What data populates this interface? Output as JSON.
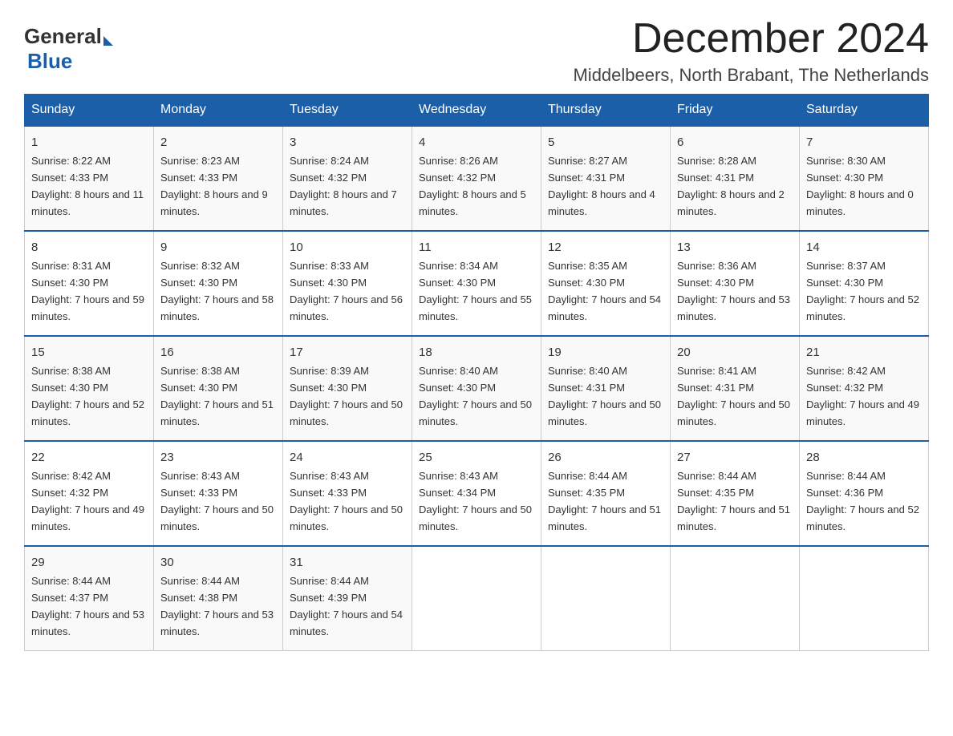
{
  "header": {
    "logo_general": "General",
    "logo_blue": "Blue",
    "month_title": "December 2024",
    "location": "Middelbeers, North Brabant, The Netherlands"
  },
  "days_of_week": [
    "Sunday",
    "Monday",
    "Tuesday",
    "Wednesday",
    "Thursday",
    "Friday",
    "Saturday"
  ],
  "weeks": [
    [
      {
        "day": "1",
        "sunrise": "Sunrise: 8:22 AM",
        "sunset": "Sunset: 4:33 PM",
        "daylight": "Daylight: 8 hours and 11 minutes."
      },
      {
        "day": "2",
        "sunrise": "Sunrise: 8:23 AM",
        "sunset": "Sunset: 4:33 PM",
        "daylight": "Daylight: 8 hours and 9 minutes."
      },
      {
        "day": "3",
        "sunrise": "Sunrise: 8:24 AM",
        "sunset": "Sunset: 4:32 PM",
        "daylight": "Daylight: 8 hours and 7 minutes."
      },
      {
        "day": "4",
        "sunrise": "Sunrise: 8:26 AM",
        "sunset": "Sunset: 4:32 PM",
        "daylight": "Daylight: 8 hours and 5 minutes."
      },
      {
        "day": "5",
        "sunrise": "Sunrise: 8:27 AM",
        "sunset": "Sunset: 4:31 PM",
        "daylight": "Daylight: 8 hours and 4 minutes."
      },
      {
        "day": "6",
        "sunrise": "Sunrise: 8:28 AM",
        "sunset": "Sunset: 4:31 PM",
        "daylight": "Daylight: 8 hours and 2 minutes."
      },
      {
        "day": "7",
        "sunrise": "Sunrise: 8:30 AM",
        "sunset": "Sunset: 4:30 PM",
        "daylight": "Daylight: 8 hours and 0 minutes."
      }
    ],
    [
      {
        "day": "8",
        "sunrise": "Sunrise: 8:31 AM",
        "sunset": "Sunset: 4:30 PM",
        "daylight": "Daylight: 7 hours and 59 minutes."
      },
      {
        "day": "9",
        "sunrise": "Sunrise: 8:32 AM",
        "sunset": "Sunset: 4:30 PM",
        "daylight": "Daylight: 7 hours and 58 minutes."
      },
      {
        "day": "10",
        "sunrise": "Sunrise: 8:33 AM",
        "sunset": "Sunset: 4:30 PM",
        "daylight": "Daylight: 7 hours and 56 minutes."
      },
      {
        "day": "11",
        "sunrise": "Sunrise: 8:34 AM",
        "sunset": "Sunset: 4:30 PM",
        "daylight": "Daylight: 7 hours and 55 minutes."
      },
      {
        "day": "12",
        "sunrise": "Sunrise: 8:35 AM",
        "sunset": "Sunset: 4:30 PM",
        "daylight": "Daylight: 7 hours and 54 minutes."
      },
      {
        "day": "13",
        "sunrise": "Sunrise: 8:36 AM",
        "sunset": "Sunset: 4:30 PM",
        "daylight": "Daylight: 7 hours and 53 minutes."
      },
      {
        "day": "14",
        "sunrise": "Sunrise: 8:37 AM",
        "sunset": "Sunset: 4:30 PM",
        "daylight": "Daylight: 7 hours and 52 minutes."
      }
    ],
    [
      {
        "day": "15",
        "sunrise": "Sunrise: 8:38 AM",
        "sunset": "Sunset: 4:30 PM",
        "daylight": "Daylight: 7 hours and 52 minutes."
      },
      {
        "day": "16",
        "sunrise": "Sunrise: 8:38 AM",
        "sunset": "Sunset: 4:30 PM",
        "daylight": "Daylight: 7 hours and 51 minutes."
      },
      {
        "day": "17",
        "sunrise": "Sunrise: 8:39 AM",
        "sunset": "Sunset: 4:30 PM",
        "daylight": "Daylight: 7 hours and 50 minutes."
      },
      {
        "day": "18",
        "sunrise": "Sunrise: 8:40 AM",
        "sunset": "Sunset: 4:30 PM",
        "daylight": "Daylight: 7 hours and 50 minutes."
      },
      {
        "day": "19",
        "sunrise": "Sunrise: 8:40 AM",
        "sunset": "Sunset: 4:31 PM",
        "daylight": "Daylight: 7 hours and 50 minutes."
      },
      {
        "day": "20",
        "sunrise": "Sunrise: 8:41 AM",
        "sunset": "Sunset: 4:31 PM",
        "daylight": "Daylight: 7 hours and 50 minutes."
      },
      {
        "day": "21",
        "sunrise": "Sunrise: 8:42 AM",
        "sunset": "Sunset: 4:32 PM",
        "daylight": "Daylight: 7 hours and 49 minutes."
      }
    ],
    [
      {
        "day": "22",
        "sunrise": "Sunrise: 8:42 AM",
        "sunset": "Sunset: 4:32 PM",
        "daylight": "Daylight: 7 hours and 49 minutes."
      },
      {
        "day": "23",
        "sunrise": "Sunrise: 8:43 AM",
        "sunset": "Sunset: 4:33 PM",
        "daylight": "Daylight: 7 hours and 50 minutes."
      },
      {
        "day": "24",
        "sunrise": "Sunrise: 8:43 AM",
        "sunset": "Sunset: 4:33 PM",
        "daylight": "Daylight: 7 hours and 50 minutes."
      },
      {
        "day": "25",
        "sunrise": "Sunrise: 8:43 AM",
        "sunset": "Sunset: 4:34 PM",
        "daylight": "Daylight: 7 hours and 50 minutes."
      },
      {
        "day": "26",
        "sunrise": "Sunrise: 8:44 AM",
        "sunset": "Sunset: 4:35 PM",
        "daylight": "Daylight: 7 hours and 51 minutes."
      },
      {
        "day": "27",
        "sunrise": "Sunrise: 8:44 AM",
        "sunset": "Sunset: 4:35 PM",
        "daylight": "Daylight: 7 hours and 51 minutes."
      },
      {
        "day": "28",
        "sunrise": "Sunrise: 8:44 AM",
        "sunset": "Sunset: 4:36 PM",
        "daylight": "Daylight: 7 hours and 52 minutes."
      }
    ],
    [
      {
        "day": "29",
        "sunrise": "Sunrise: 8:44 AM",
        "sunset": "Sunset: 4:37 PM",
        "daylight": "Daylight: 7 hours and 53 minutes."
      },
      {
        "day": "30",
        "sunrise": "Sunrise: 8:44 AM",
        "sunset": "Sunset: 4:38 PM",
        "daylight": "Daylight: 7 hours and 53 minutes."
      },
      {
        "day": "31",
        "sunrise": "Sunrise: 8:44 AM",
        "sunset": "Sunset: 4:39 PM",
        "daylight": "Daylight: 7 hours and 54 minutes."
      },
      null,
      null,
      null,
      null
    ]
  ]
}
